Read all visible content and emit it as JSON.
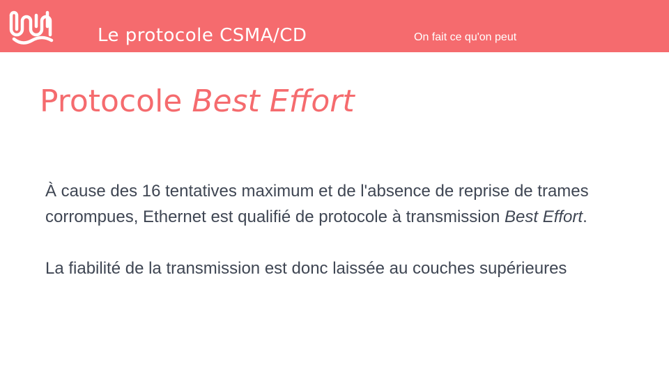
{
  "header": {
    "section_title": "Le protocole CSMA/CD",
    "tagline": "On fait ce qu'on peut",
    "logo_icon": "wave-logo-icon"
  },
  "slide": {
    "title_plain": "Protocole ",
    "title_italic": "Best Effort",
    "paragraph1_part1": "À cause des 16 tentatives maximum et de l'absence de reprise de trames corrompues, Ethernet est qualifié de protocole à transmission ",
    "paragraph1_italic": "Best Effort",
    "paragraph1_end": ".",
    "paragraph2": "La fiabilité de la transmission est donc laissée au couches supérieures"
  },
  "colors": {
    "accent": "#f56b6e",
    "text": "#3f4653",
    "header_text": "#ffffff"
  }
}
